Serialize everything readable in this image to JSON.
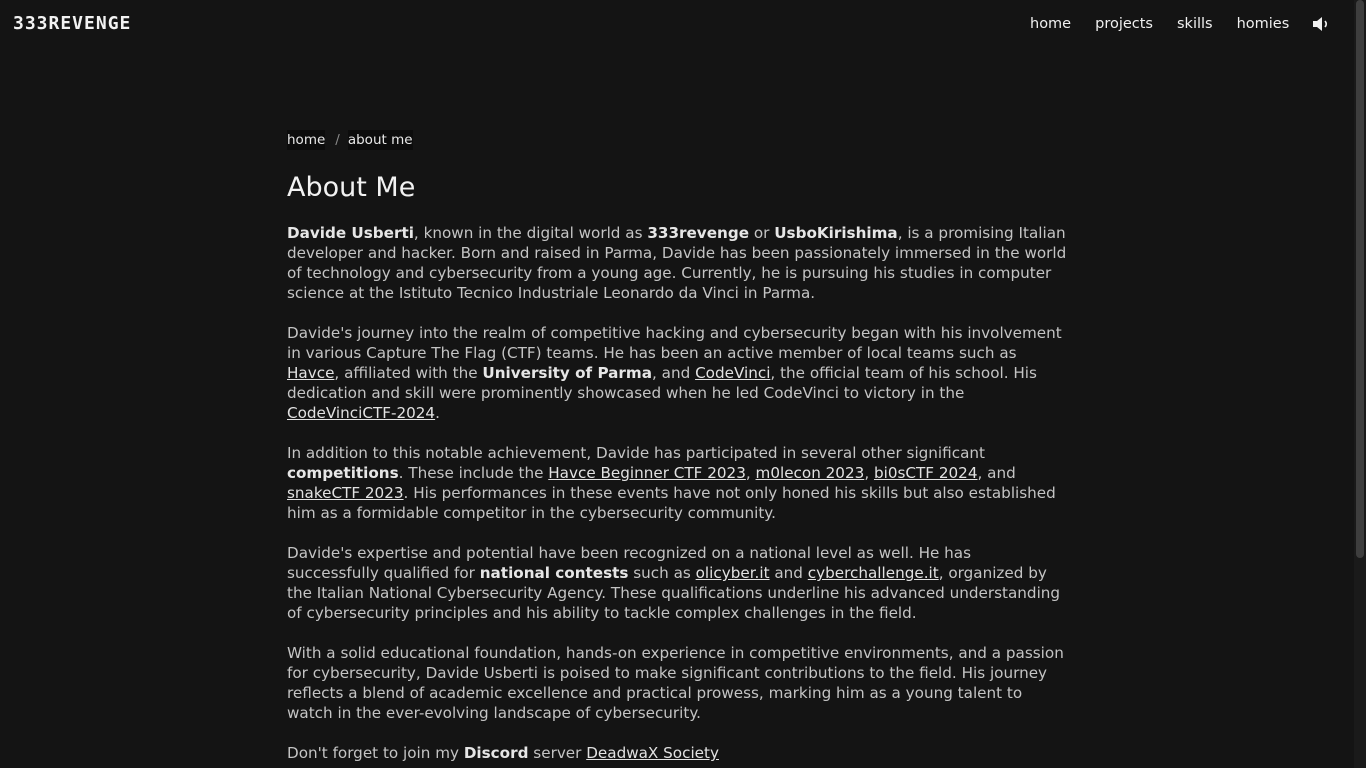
{
  "header": {
    "logo": "333REVENGE",
    "nav": [
      {
        "label": "home"
      },
      {
        "label": "projects"
      },
      {
        "label": "skills"
      },
      {
        "label": "homies"
      }
    ],
    "sound_icon": "speaker-icon"
  },
  "breadcrumb": {
    "home": "home",
    "separator": "/",
    "current": "about me"
  },
  "page_title": "About Me",
  "p1": {
    "name": "Davide Usberti",
    "t1": ", known in the digital world as ",
    "alias1": "333revenge",
    "t2": " or ",
    "alias2": "UsboKirishima",
    "t3": ", is a promising Italian developer and hacker. Born and raised in Parma, Davide has been passionately immersed in the world of technology and cybersecurity from a young age. Currently, he is pursuing his studies in computer science at the Istituto Tecnico Industriale Leonardo da Vinci in Parma."
  },
  "p2": {
    "t1": "Davide's journey into the realm of competitive hacking and cybersecurity began with his involvement in various Capture The Flag (CTF) teams. He has been an active member of local teams such as ",
    "link1": "Havce",
    "t2": ", affiliated with the ",
    "uni": "University of Parma",
    "t3": ", and ",
    "link2": "CodeVinci",
    "t4": ", the official team of his school. His dedication and skill were prominently showcased when he led CodeVinci to victory in the ",
    "link3": "CodeVinciCTF-2024",
    "t5": "."
  },
  "p3": {
    "t1": "In addition to this notable achievement, Davide has participated in several other significant ",
    "bold": "competitions",
    "t2": ". These include the ",
    "link1": "Havce Beginner CTF 2023",
    "t3": ", ",
    "link2": "m0lecon 2023",
    "t4": ", ",
    "link3": "bi0sCTF 2024",
    "t5": ", and ",
    "link4": "snakeCTF 2023",
    "t6": ". His performances in these events have not only honed his skills but also established him as a formidable competitor in the cybersecurity community."
  },
  "p4": {
    "t1": "Davide's expertise and potential have been recognized on a national level as well. He has successfully qualified for ",
    "bold": "national contests",
    "t2": " such as ",
    "link1": "olicyber.it",
    "t3": " and ",
    "link2": "cyberchallenge.it",
    "t4": ", organized by the Italian National Cybersecurity Agency. These qualifications underline his advanced understanding of cybersecurity principles and his ability to tackle complex challenges in the field."
  },
  "p5": {
    "t1": "With a solid educational foundation, hands-on experience in competitive environments, and a passion for cybersecurity, Davide Usberti is poised to make significant contributions to the field. His journey reflects a blend of academic excellence and practical prowess, marking him as a young talent to watch in the ever-evolving landscape of cybersecurity."
  },
  "p6": {
    "t1": "Don't forget to join my ",
    "bold": "Discord",
    "t2": " server ",
    "link1": "DeadwaX Society"
  },
  "colors": {
    "background": "#141414",
    "text": "#c4c4c4",
    "heading": "#f2f2f2"
  }
}
